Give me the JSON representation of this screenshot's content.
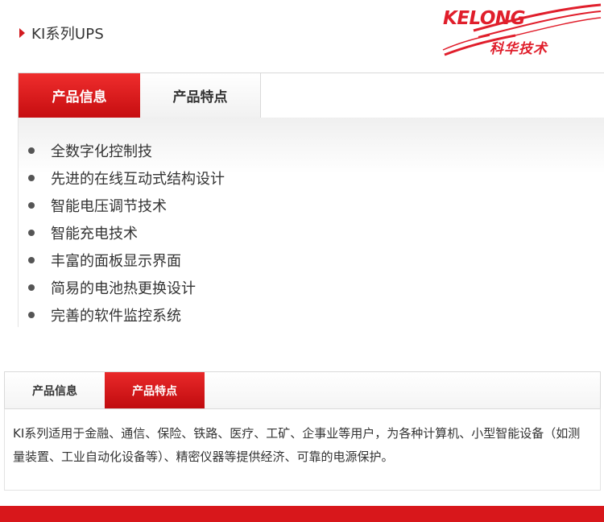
{
  "breadcrumb": {
    "title": "KI系列UPS"
  },
  "logo": {
    "wordmark": "KELONG",
    "cn_name": "科华技术",
    "brand_color": "#e01e2b"
  },
  "section1": {
    "tabs": [
      {
        "label": "产品信息",
        "active": true
      },
      {
        "label": "产品特点",
        "active": false
      }
    ],
    "features": [
      "全数字化控制技",
      "先进的在线互动式结构设计",
      "智能电压调节技术",
      "智能充电技术",
      "丰富的面板显示界面",
      "简易的电池热更换设计",
      "完善的软件监控系统"
    ]
  },
  "section2": {
    "tabs": [
      {
        "label": "产品信息",
        "active": false
      },
      {
        "label": "产品特点",
        "active": true
      }
    ],
    "description": "KI系列适用于金融、通信、保险、铁路、医疗、工矿、企事业等用户，为各种计算机、小型智能设备（如测量装置、工业自动化设备等）、精密仪器等提供经济、可靠的电源保护。"
  },
  "colors": {
    "accent_red": "#d21a1f",
    "footer_red": "#d8171b"
  }
}
